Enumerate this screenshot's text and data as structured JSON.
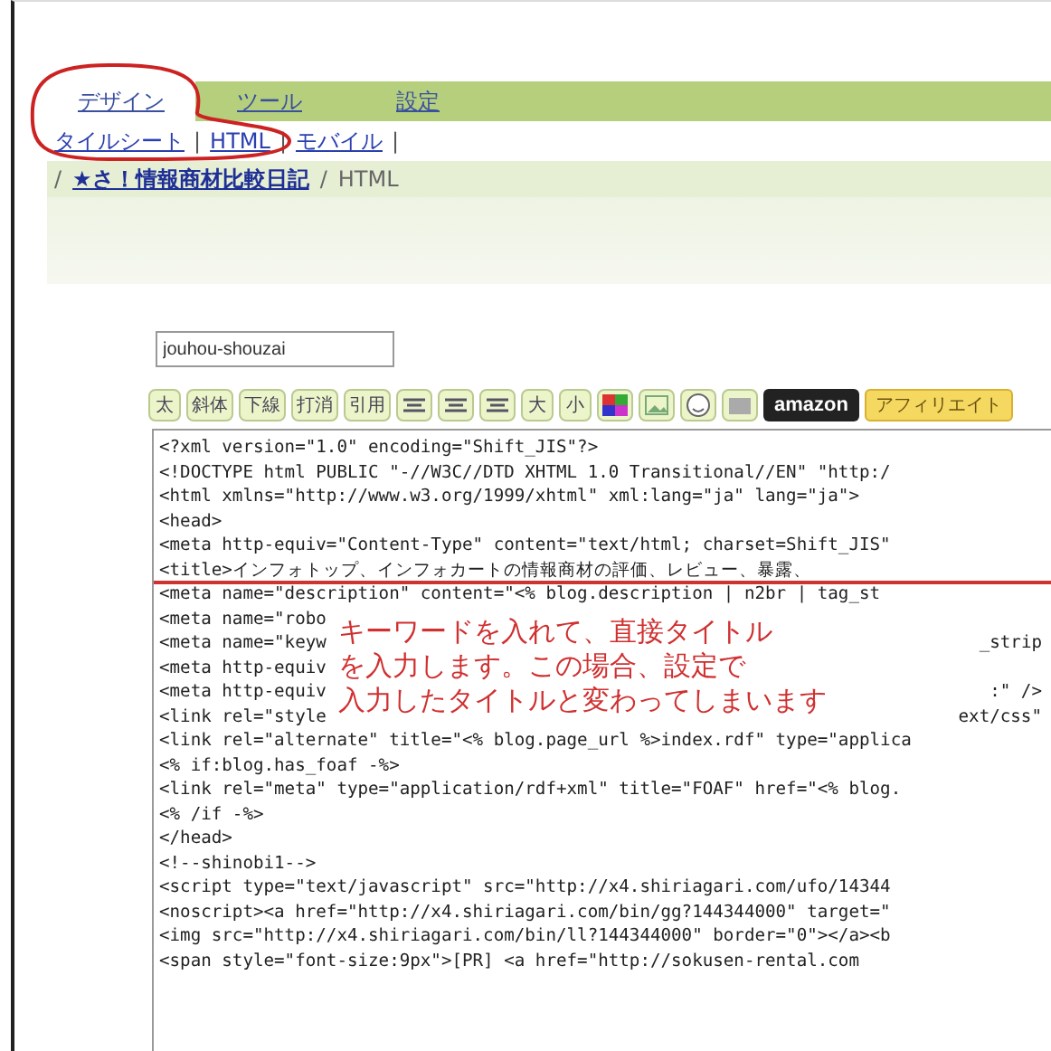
{
  "tabs": [
    {
      "label": "デザイン",
      "selected": true
    },
    {
      "label": "ツール",
      "selected": false
    },
    {
      "label": "設定",
      "selected": false
    }
  ],
  "subnav": [
    {
      "label": "タイルシート",
      "separator": "|"
    },
    {
      "label": "HTML",
      "separator": "|"
    },
    {
      "label": "モバイル",
      "separator": "|"
    }
  ],
  "breadcrumb": [
    {
      "kind": "separator",
      "text": "/"
    },
    {
      "kind": "link",
      "text": "★さ！情報商材比較日記"
    },
    {
      "kind": "separator",
      "text": "/"
    },
    {
      "kind": "current",
      "text": "HTML"
    }
  ],
  "slug_field": {
    "value": "jouhou-shouzai"
  },
  "toolbar": [
    {
      "kind": "text",
      "label": "太"
    },
    {
      "kind": "text",
      "label": "斜体"
    },
    {
      "kind": "text",
      "label": "下線"
    },
    {
      "kind": "text",
      "label": "打消"
    },
    {
      "kind": "text",
      "label": "引用"
    },
    {
      "kind": "align"
    },
    {
      "kind": "align"
    },
    {
      "kind": "align"
    },
    {
      "kind": "text",
      "label": "大"
    },
    {
      "kind": "text",
      "label": "小"
    },
    {
      "kind": "color"
    },
    {
      "kind": "image"
    },
    {
      "kind": "emoji"
    },
    {
      "kind": "file"
    },
    {
      "kind": "amazon",
      "label": "amazon"
    },
    {
      "kind": "affiliate",
      "label": "アフィリエイト"
    }
  ],
  "code_lines": [
    {
      "text": "<?xml version=\"1.0\" encoding=\"Shift_JIS\"?>"
    },
    {
      "text": "<!DOCTYPE html PUBLIC \"-//W3C//DTD XHTML 1.0 Transitional//EN\" \"http:/"
    },
    {
      "text": "<html xmlns=\"http://www.w3.org/1999/xhtml\" xml:lang=\"ja\" lang=\"ja\">"
    },
    {
      "text": "<head>"
    },
    {
      "text": "<meta http-equiv=\"Content-Type\" content=\"text/html; charset=Shift_JIS\""
    },
    {
      "text": "<title>インフォトップ、インフォカートの情報商材の評価、レビュー、暴露、"
    },
    {
      "text": "<meta name=\"description\" content=\"<% blog.description | n2br | tag_st"
    },
    {
      "text": "<meta name=\"robo"
    },
    {
      "text": "<meta name=\"keyw",
      "tail": "_strip"
    },
    {
      "text": "<meta http-equiv"
    },
    {
      "text": "<meta http-equiv",
      "tail": ":\" />"
    },
    {
      "text": "<link rel=\"style",
      "tail": "ext/css\""
    },
    {
      "text": "<link rel=\"alternate\" title=\"<% blog.page_url %>index.rdf\" type=\"applica"
    },
    {
      "text": "<% if:blog.has_foaf -%>"
    },
    {
      "text": "<link rel=\"meta\" type=\"application/rdf+xml\" title=\"FOAF\" href=\"<% blog."
    },
    {
      "text": "<% /if -%>"
    },
    {
      "text": "</head>"
    },
    {
      "text": "<!--shinobi1-->"
    },
    {
      "text": "<script type=\"text/javascript\" src=\"http://x4.shiriagari.com/ufo/14344"
    },
    {
      "text": "<noscript><a href=\"http://x4.shiriagari.com/bin/gg?144344000\" target=\""
    },
    {
      "text": "<img src=\"http://x4.shiriagari.com/bin/ll?144344000\" border=\"0\"></a><b"
    },
    {
      "text": "<span style=\"font-size:9px\">[PR] <a href=\"http://sokusen-rental.com"
    }
  ],
  "annotation": [
    "キーワードを入れて、直接タイトル",
    "を入力します。この場合、設定で",
    "入力したタイトルと変わってしまいます"
  ]
}
